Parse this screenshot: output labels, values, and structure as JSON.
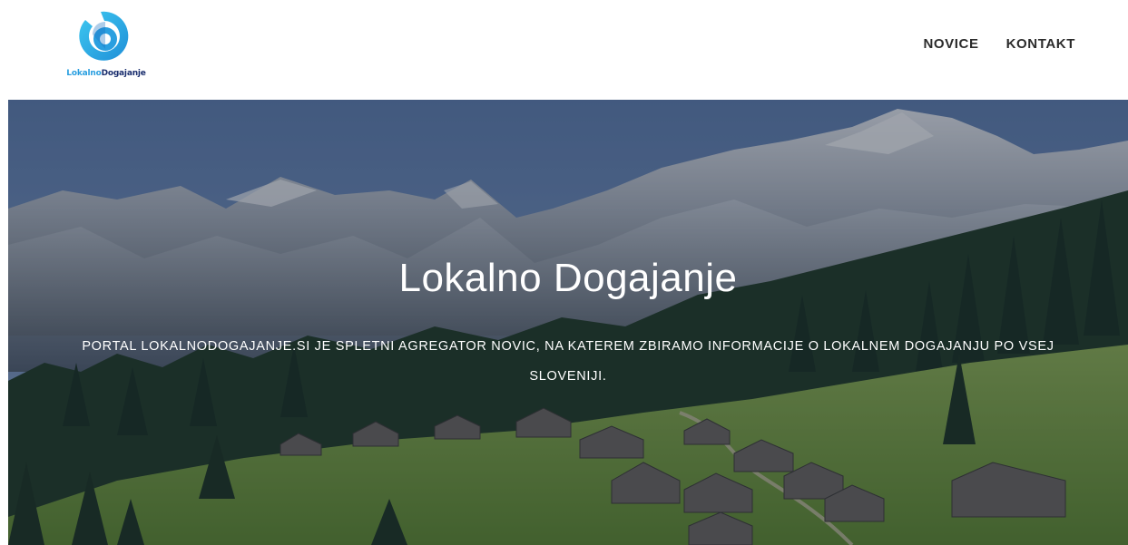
{
  "brand": {
    "logo_text_part1": "Lokalno",
    "logo_text_part2": "Dogajanje",
    "colors": {
      "primary_blue": "#2a9fe0",
      "light_blue": "#3ec8f0",
      "dark_navy": "#1a2e6e"
    }
  },
  "nav": {
    "items": [
      {
        "label": "NOVICE"
      },
      {
        "label": "KONTAKT"
      }
    ]
  },
  "hero": {
    "title": "Lokalno Dogajanje",
    "subtitle": "PORTAL LOKALNODOGAJANJE.SI JE SPLETNI AGREGATOR NOVIC, NA KATEREM ZBIRAMO INFORMACIJE O LOKALNEM DOGAJANJU PO VSEJ SLOVENIJI."
  }
}
